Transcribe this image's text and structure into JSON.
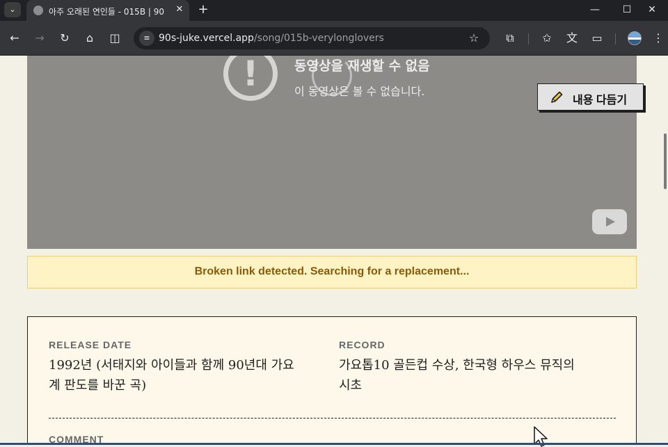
{
  "browser": {
    "tab_title": "아주 오래된 연인들 - 015B | 90",
    "url_host": "90s-juke.vercel.app",
    "url_path": "/song/015b-verylonglovers"
  },
  "video": {
    "error_title": "동영상을 재생할 수 없음",
    "error_subtitle": "이 동영상은 볼 수 없습니다."
  },
  "summary_button": {
    "label": "내용 다듬기"
  },
  "notice": {
    "text": "Broken link detected. Searching for a replacement..."
  },
  "details": {
    "release_date_label": "RELEASE DATE",
    "release_date_line1": "1992년 (서태지와 아이들과 함께 90년대 가요",
    "release_date_line2": "계 판도를 바꾼 곡)",
    "record_label": "RECORD",
    "record_line1": "가요톱10 골든컵 수상, 한국형 하우스 뮤직의",
    "record_line2": "시초",
    "comment_label": "COMMENT"
  }
}
